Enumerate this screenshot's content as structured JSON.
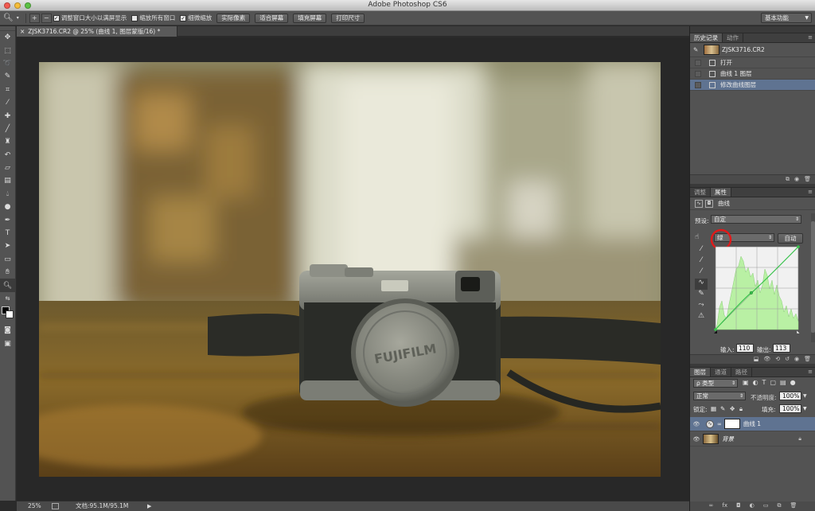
{
  "window": {
    "title": "Adobe Photoshop CS6"
  },
  "options_bar": {
    "check_resize_windows": "调整窗口大小以满屏显示",
    "check_zoom_all": "缩放所有窗口",
    "check_scrubby_zoom": "细微缩放",
    "btn_actual_pixels": "实际像素",
    "btn_fit_screen": "适合屏幕",
    "btn_fill_screen": "填充屏幕",
    "btn_print_size": "打印尺寸",
    "workspace": "基本功能"
  },
  "document": {
    "tab_title": "ZJSK3716.CR2 @ 25% (曲线 1, 图层蒙版/16) *"
  },
  "status": {
    "zoom": "25%",
    "doc_info": "文档:95.1M/95.1M"
  },
  "history": {
    "tabs": [
      "历史记录",
      "动作"
    ],
    "snapshot": "ZJSK3716.CR2",
    "steps": [
      "打开",
      "曲线 1 图层",
      "修改曲线图层"
    ],
    "selected_index": 2
  },
  "properties": {
    "tabs": [
      "调整",
      "属性"
    ],
    "header": "曲线",
    "preset_label": "预设:",
    "preset_value": "自定",
    "channel_value": "绿",
    "auto_label": "自动",
    "input_label": "输入:",
    "input_value": "110",
    "output_label": "输出:",
    "output_value": "113",
    "curve": {
      "input": 110,
      "output": 113,
      "channel": "green"
    }
  },
  "layers": {
    "tabs": [
      "图层",
      "通道",
      "路径"
    ],
    "filter_kind": "ρ 类型",
    "blend_mode": "正常",
    "opacity_label": "不透明度:",
    "opacity_value": "100%",
    "lock_label": "锁定:",
    "fill_label": "填充:",
    "fill_value": "100%",
    "items": [
      {
        "name": "曲线 1",
        "selected": true
      },
      {
        "name": "背景",
        "selected": false
      }
    ]
  },
  "photo": {
    "lens_cap_text": "FUJIFILM"
  },
  "colors": {
    "selection": "#5f7391",
    "panel": "#535353",
    "annotation_circle": "#e11a1a",
    "histogram_fill": "#b9f0a4",
    "curve_line": "#36c24a"
  }
}
